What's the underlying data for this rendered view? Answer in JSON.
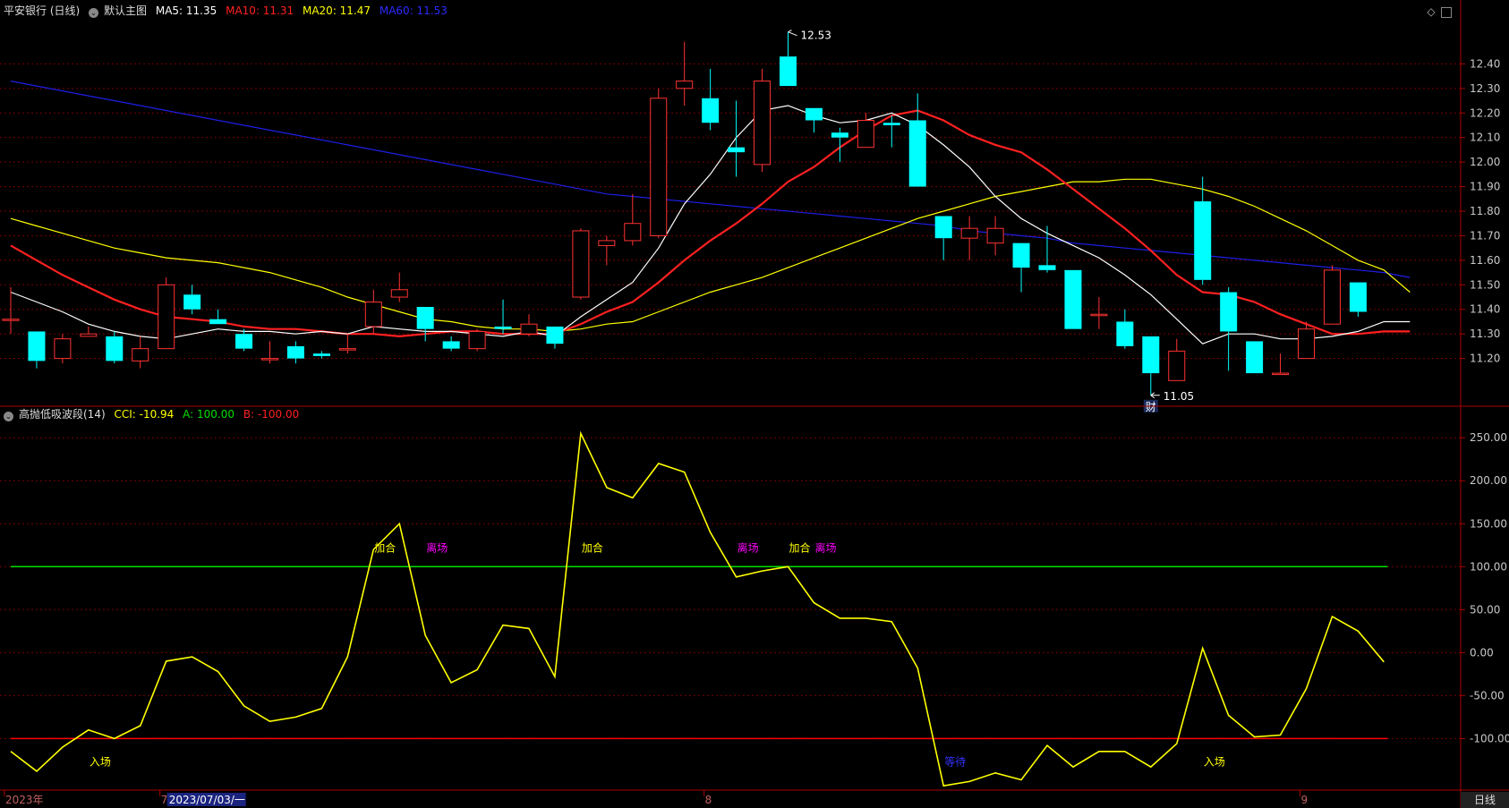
{
  "header": {
    "stock": "平安银行 (日线)",
    "main_chart": "默认主图",
    "ma5": "MA5: 11.35",
    "ma10": "MA10: 11.31",
    "ma20": "MA20: 11.47",
    "ma60": "MA60: 11.53"
  },
  "indicator_header": {
    "name": "高抛低吸波段(14)",
    "cci": "CCI: -10.94",
    "a": "A: 100.00",
    "b": "B: -100.00"
  },
  "colors": {
    "up": "#ff3232",
    "down": "#00ffff",
    "ma5": "#ffffff",
    "ma10": "#ff2020",
    "ma20": "#ffff00",
    "ma60": "#1e1ee6",
    "cci": "#ffff00",
    "line_a": "#00e000",
    "line_b": "#ff0000",
    "grid": "#7a0000",
    "axis_text": "#c8c8c8"
  },
  "chart_data": {
    "type": "candlestick",
    "price_axis": {
      "ticks": [
        "12.40",
        "12.30",
        "12.20",
        "12.10",
        "12.00",
        "11.90",
        "11.80",
        "11.70",
        "11.60",
        "11.50",
        "11.40",
        "11.30",
        "11.20"
      ],
      "range": [
        11.02,
        12.58
      ]
    },
    "candles": [
      {
        "o": 11.36,
        "c": 11.36,
        "h": 11.49,
        "l": 11.3
      },
      {
        "o": 11.31,
        "c": 11.19,
        "h": 11.3,
        "l": 11.16
      },
      {
        "o": 11.2,
        "c": 11.28,
        "h": 11.3,
        "l": 11.18
      },
      {
        "o": 11.29,
        "c": 11.3,
        "h": 11.33,
        "l": 11.29
      },
      {
        "o": 11.29,
        "c": 11.19,
        "h": 11.31,
        "l": 11.18
      },
      {
        "o": 11.19,
        "c": 11.24,
        "h": 11.29,
        "l": 11.16
      },
      {
        "o": 11.24,
        "c": 11.5,
        "h": 11.53,
        "l": 11.24
      },
      {
        "o": 11.46,
        "c": 11.4,
        "h": 11.5,
        "l": 11.38
      },
      {
        "o": 11.36,
        "c": 11.34,
        "h": 11.4,
        "l": 11.34
      },
      {
        "o": 11.3,
        "c": 11.24,
        "h": 11.32,
        "l": 11.23
      },
      {
        "o": 11.2,
        "c": 11.2,
        "h": 11.27,
        "l": 11.18
      },
      {
        "o": 11.25,
        "c": 11.2,
        "h": 11.27,
        "l": 11.18
      },
      {
        "o": 11.22,
        "c": 11.21,
        "h": 11.23,
        "l": 11.2
      },
      {
        "o": 11.24,
        "c": 11.24,
        "h": 11.3,
        "l": 11.22
      },
      {
        "o": 11.33,
        "c": 11.43,
        "h": 11.48,
        "l": 11.3
      },
      {
        "o": 11.45,
        "c": 11.48,
        "h": 11.55,
        "l": 11.43
      },
      {
        "o": 11.41,
        "c": 11.32,
        "h": 11.41,
        "l": 11.27
      },
      {
        "o": 11.27,
        "c": 11.24,
        "h": 11.29,
        "l": 11.23
      },
      {
        "o": 11.24,
        "c": 11.31,
        "h": 11.32,
        "l": 11.23
      },
      {
        "o": 11.33,
        "c": 11.32,
        "h": 11.44,
        "l": 11.3
      },
      {
        "o": 11.3,
        "c": 11.34,
        "h": 11.38,
        "l": 11.29
      },
      {
        "o": 11.33,
        "c": 11.26,
        "h": 11.33,
        "l": 11.24
      },
      {
        "o": 11.45,
        "c": 11.72,
        "h": 11.73,
        "l": 11.44
      },
      {
        "o": 11.66,
        "c": 11.68,
        "h": 11.7,
        "l": 11.58
      },
      {
        "o": 11.68,
        "c": 11.75,
        "h": 11.87,
        "l": 11.66
      },
      {
        "o": 11.7,
        "c": 12.26,
        "h": 12.3,
        "l": 11.69
      },
      {
        "o": 12.3,
        "c": 12.33,
        "h": 12.49,
        "l": 12.23
      },
      {
        "o": 12.26,
        "c": 12.16,
        "h": 12.38,
        "l": 12.13
      },
      {
        "o": 12.06,
        "c": 12.04,
        "h": 12.25,
        "l": 11.94
      },
      {
        "o": 11.99,
        "c": 12.33,
        "h": 12.38,
        "l": 11.96
      },
      {
        "o": 12.43,
        "c": 12.31,
        "h": 12.53,
        "l": 12.31
      },
      {
        "o": 12.22,
        "c": 12.17,
        "h": 12.22,
        "l": 12.12
      },
      {
        "o": 12.12,
        "c": 12.1,
        "h": 12.14,
        "l": 12.0
      },
      {
        "o": 12.06,
        "c": 12.17,
        "h": 12.2,
        "l": 12.06
      },
      {
        "o": 12.16,
        "c": 12.15,
        "h": 12.19,
        "l": 12.06
      },
      {
        "o": 12.17,
        "c": 11.9,
        "h": 12.28,
        "l": 11.9
      },
      {
        "o": 11.78,
        "c": 11.69,
        "h": 11.78,
        "l": 11.6
      },
      {
        "o": 11.69,
        "c": 11.73,
        "h": 11.78,
        "l": 11.6
      },
      {
        "o": 11.67,
        "c": 11.73,
        "h": 11.78,
        "l": 11.62
      },
      {
        "o": 11.67,
        "c": 11.57,
        "h": 11.67,
        "l": 11.47
      },
      {
        "o": 11.58,
        "c": 11.56,
        "h": 11.74,
        "l": 11.55
      },
      {
        "o": 11.56,
        "c": 11.32,
        "h": 11.56,
        "l": 11.32
      },
      {
        "o": 11.38,
        "c": 11.38,
        "h": 11.45,
        "l": 11.32
      },
      {
        "o": 11.35,
        "c": 11.25,
        "h": 11.4,
        "l": 11.24
      },
      {
        "o": 11.29,
        "c": 11.14,
        "h": 11.29,
        "l": 11.05
      },
      {
        "o": 11.11,
        "c": 11.23,
        "h": 11.28,
        "l": 11.11
      },
      {
        "o": 11.84,
        "c": 11.52,
        "h": 11.94,
        "l": 11.5
      },
      {
        "o": 11.47,
        "c": 11.31,
        "h": 11.49,
        "l": 11.15
      },
      {
        "o": 11.27,
        "c": 11.14,
        "h": 11.27,
        "l": 11.14
      },
      {
        "o": 11.14,
        "c": 11.14,
        "h": 11.22,
        "l": 11.14
      },
      {
        "o": 11.2,
        "c": 11.32,
        "h": 11.35,
        "l": 11.2
      },
      {
        "o": 11.34,
        "c": 11.56,
        "h": 11.58,
        "l": 11.34
      },
      {
        "o": 11.51,
        "c": 11.39,
        "h": 11.51,
        "l": 11.37
      }
    ],
    "ma5": [
      11.47,
      11.43,
      11.39,
      11.34,
      11.31,
      11.29,
      11.28,
      11.3,
      11.32,
      11.31,
      11.31,
      11.3,
      11.31,
      11.3,
      11.33,
      11.32,
      11.31,
      11.31,
      11.3,
      11.29,
      11.31,
      11.29,
      11.37,
      11.44,
      11.51,
      11.65,
      11.83,
      11.95,
      12.1,
      12.21,
      12.23,
      12.19,
      12.16,
      12.17,
      12.2,
      12.15,
      12.07,
      11.98,
      11.86,
      11.77,
      11.71,
      11.66,
      11.61,
      11.54,
      11.46,
      11.36,
      11.26,
      11.3,
      11.3,
      11.28,
      11.28,
      11.29,
      11.31,
      11.35,
      11.35
    ],
    "ma10": [
      11.66,
      11.6,
      11.54,
      11.49,
      11.44,
      11.4,
      11.37,
      11.36,
      11.35,
      11.33,
      11.32,
      11.32,
      11.31,
      11.3,
      11.3,
      11.29,
      11.3,
      11.31,
      11.31,
      11.3,
      11.3,
      11.3,
      11.34,
      11.39,
      11.43,
      11.51,
      11.6,
      11.68,
      11.75,
      11.83,
      11.92,
      11.98,
      12.06,
      12.13,
      12.19,
      12.21,
      12.17,
      12.11,
      12.07,
      12.04,
      11.97,
      11.89,
      11.81,
      11.73,
      11.64,
      11.54,
      11.47,
      11.46,
      11.43,
      11.38,
      11.34,
      11.3,
      11.3,
      11.31,
      11.31
    ],
    "ma20": [
      11.77,
      11.74,
      11.71,
      11.68,
      11.65,
      11.63,
      11.61,
      11.6,
      11.59,
      11.57,
      11.55,
      11.52,
      11.49,
      11.45,
      11.42,
      11.39,
      11.36,
      11.35,
      11.33,
      11.32,
      11.32,
      11.31,
      11.32,
      11.34,
      11.35,
      11.39,
      11.43,
      11.47,
      11.5,
      11.53,
      11.57,
      11.61,
      11.65,
      11.69,
      11.73,
      11.77,
      11.8,
      11.83,
      11.86,
      11.88,
      11.9,
      11.92,
      11.92,
      11.93,
      11.93,
      11.91,
      11.89,
      11.86,
      11.82,
      11.77,
      11.72,
      11.66,
      11.6,
      11.56,
      11.47
    ],
    "ma60": [
      12.33,
      12.31,
      12.29,
      12.27,
      12.25,
      12.23,
      12.21,
      12.19,
      12.17,
      12.15,
      12.13,
      12.11,
      12.09,
      12.07,
      12.05,
      12.03,
      12.01,
      11.99,
      11.97,
      11.95,
      11.93,
      11.91,
      11.89,
      11.87,
      11.86,
      11.85,
      11.84,
      11.83,
      11.82,
      11.81,
      11.8,
      11.79,
      11.78,
      11.77,
      11.76,
      11.75,
      11.74,
      11.72,
      11.71,
      11.7,
      11.69,
      11.67,
      11.66,
      11.65,
      11.64,
      11.63,
      11.62,
      11.61,
      11.6,
      11.59,
      11.58,
      11.57,
      11.56,
      11.55,
      11.53
    ],
    "max_label": "12.53",
    "min_label": "11.05",
    "event_tag": "财",
    "cci_axis": {
      "ticks": [
        "250.00",
        "200.00",
        "150.00",
        "100.00",
        "50.00",
        "0.00",
        "-50.00",
        "-100.00"
      ],
      "range": [
        -160,
        270
      ]
    },
    "cci": [
      -115,
      -138,
      -110,
      -90,
      -100,
      -85,
      -10,
      -5,
      -22,
      -62,
      -80,
      -75,
      -65,
      -5,
      120,
      150,
      20,
      -35,
      -20,
      32,
      28,
      -28,
      255,
      192,
      180,
      220,
      210,
      140,
      88,
      95,
      100,
      58,
      40,
      40,
      36,
      -18,
      -155,
      -150,
      -140,
      -148,
      -108,
      -133,
      -115,
      -115,
      -133,
      -106,
      5,
      -73,
      -98,
      -96,
      -42,
      42,
      25,
      -10.94
    ],
    "signals": [
      {
        "label": "入场",
        "i": 3,
        "color": "#ffff00",
        "pos": "low"
      },
      {
        "label": "加合",
        "i": 14,
        "color": "#ffff00",
        "pos": "high"
      },
      {
        "label": "离场",
        "i": 16,
        "color": "#ff00ff",
        "pos": "high"
      },
      {
        "label": "加合",
        "i": 22,
        "color": "#ffff00",
        "pos": "high"
      },
      {
        "label": "离场",
        "i": 28,
        "color": "#ff00ff",
        "pos": "high"
      },
      {
        "label": "加合",
        "i": 30,
        "color": "#ffff00",
        "pos": "high"
      },
      {
        "label": "离场",
        "i": 31,
        "color": "#ff00ff",
        "pos": "high"
      },
      {
        "label": "等待",
        "i": 36,
        "color": "#3333ff",
        "pos": "low"
      },
      {
        "label": "入场",
        "i": 46,
        "color": "#ffff00",
        "pos": "low"
      }
    ],
    "date_labels": [
      {
        "label": "2023年",
        "i": 0
      },
      {
        "label": "7",
        "i": 6
      },
      {
        "label": "2023/07/03/一",
        "i": 6,
        "highlight": true
      },
      {
        "label": "8",
        "i": 27
      },
      {
        "label": "9",
        "i": 50
      }
    ]
  },
  "bottom_tab": "日线"
}
